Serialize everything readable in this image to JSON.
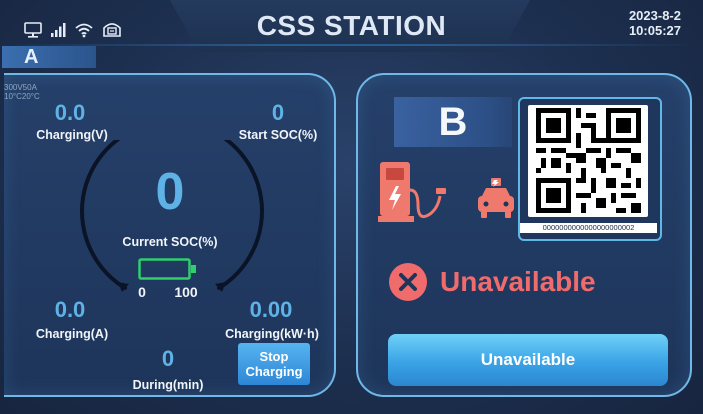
{
  "header": {
    "title": "CSS STATION",
    "date": "2023-8-2",
    "time": "10:05:27"
  },
  "connector_a": {
    "tab_label": "A",
    "note_line1": "300V50A",
    "note_line2": "10°C20°C",
    "voltage_value": "0.0",
    "voltage_label": "Charging(V)",
    "start_soc_value": "0",
    "start_soc_label": "Start SOC(%)",
    "current_soc_value": "0",
    "current_soc_label": "Current SOC(%)",
    "soc_min": "0",
    "soc_max": "100",
    "current_value": "0.0",
    "current_label": "Charging(A)",
    "energy_value": "0.00",
    "energy_label": "Charging(kW·h)",
    "duration_value": "0",
    "duration_label": "During(min)",
    "stop_line1": "Stop",
    "stop_line2": "Charging"
  },
  "connector_b": {
    "label": "B",
    "qr_text": "0000000000000000000002",
    "status_text": "Unavailable",
    "button_label": "Unavailable"
  },
  "colors": {
    "accent": "#5fb2e6",
    "error": "#f06b6b",
    "charger": "#f0796e"
  }
}
